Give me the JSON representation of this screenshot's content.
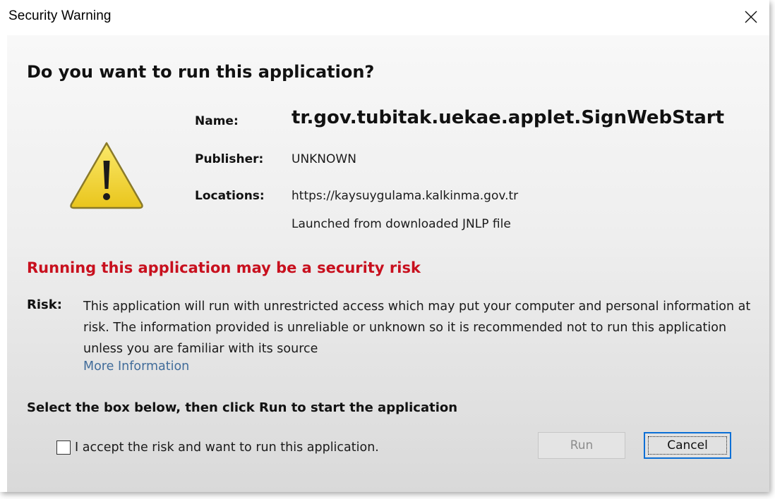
{
  "window": {
    "title": "Security Warning"
  },
  "dialog": {
    "question": "Do you want to run this application?",
    "name_label": "Name:",
    "name_value": "tr.gov.tubitak.uekae.applet.SignWebStart",
    "publisher_label": "Publisher:",
    "publisher_value": "UNKNOWN",
    "locations_label": "Locations:",
    "location_url": "https://kaysuygulama.kalkinma.gov.tr",
    "location_launch": "Launched from downloaded JNLP file",
    "risk_heading": "Running this application may be a security risk",
    "risk_label": "Risk:",
    "risk_text": "This application will run with unrestricted access which may put your computer and personal information at risk. The information provided is unreliable or unknown so it is recommended not to run this application unless you are familiar with its source",
    "more_info": "More Information",
    "select_instruction": "Select the box below, then click Run to start the application",
    "accept_label": "I accept the risk and want to run this application.",
    "accept_checked": false,
    "run_label": "Run",
    "run_enabled": false,
    "cancel_label": "Cancel"
  },
  "icons": {
    "warning": "warning-triangle-icon",
    "close": "close-icon"
  },
  "colors": {
    "risk_heading": "#c8101e",
    "link": "#416c9a",
    "focus_border": "#0b6fd6",
    "warning_fill": "#f3d63a"
  }
}
